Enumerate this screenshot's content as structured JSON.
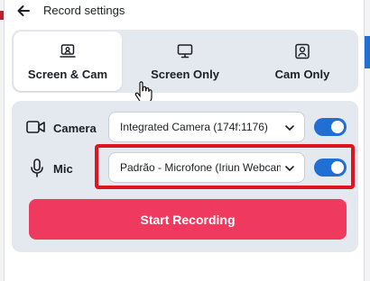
{
  "header": {
    "title": "Record settings"
  },
  "tabs": [
    {
      "label": "Screen & Cam",
      "icon": "screen-cam-icon",
      "active": true
    },
    {
      "label": "Screen Only",
      "icon": "monitor-icon",
      "active": false
    },
    {
      "label": "Cam Only",
      "icon": "person-icon",
      "active": false
    }
  ],
  "camera": {
    "label": "Camera",
    "icon": "camera-icon",
    "selected": "Integrated Camera (174f:1176)",
    "enabled": true
  },
  "mic": {
    "label": "Mic",
    "icon": "microphone-icon",
    "selected": "Padrão - Microfone (Iriun Webcam)",
    "enabled": true
  },
  "actions": {
    "start_label": "Start Recording"
  },
  "colors": {
    "accent": "#1f6fd4",
    "start_button": "#f0395f",
    "highlight": "#e0141e",
    "panel_bg": "#e4e8ef"
  }
}
